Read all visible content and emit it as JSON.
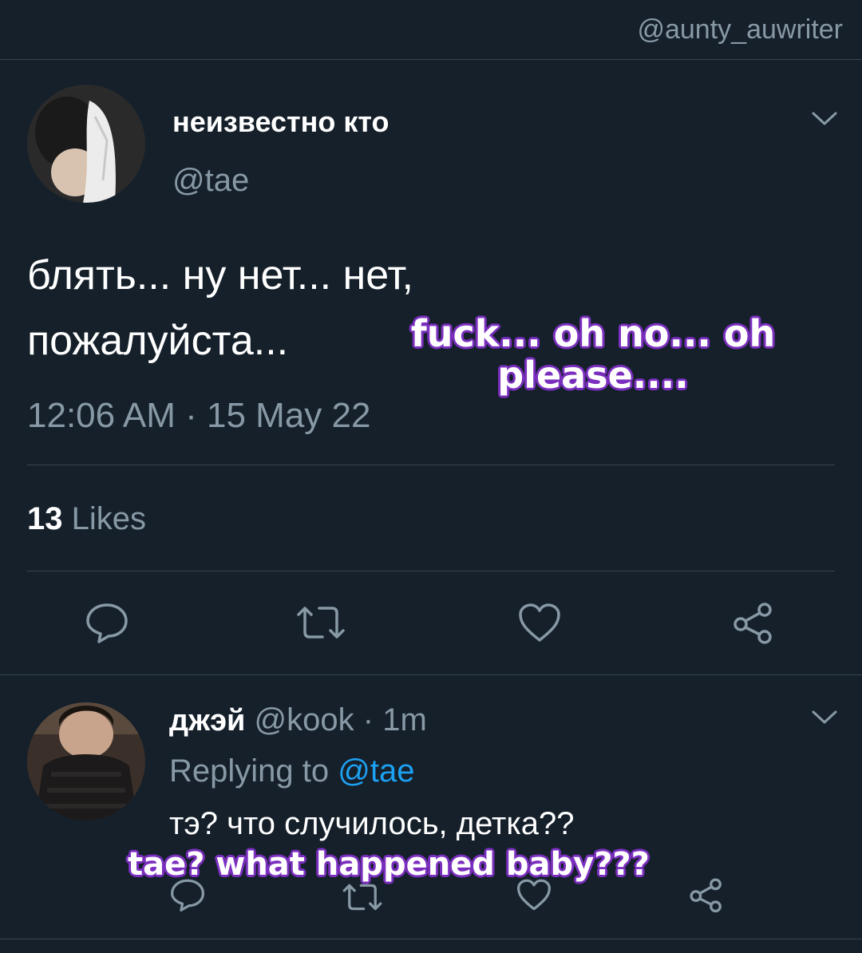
{
  "watermark": "@aunty_auwriter",
  "tweet": {
    "display_name": "неизвестно кто",
    "handle": "@tae",
    "text_line1": "блять... ну нет... нет,",
    "text_line2": "пожалуйста...",
    "translation_line1": "fuck... oh no... oh",
    "translation_line2": "please....",
    "timestamp": "12:06 AM · 15 May 22",
    "likes_count": "13",
    "likes_label": "Likes"
  },
  "reply": {
    "display_name": "джэй",
    "handle": "@kook",
    "time": "· 1m",
    "replying_prefix": "Replying to",
    "replying_mention": "@tae",
    "text": "тэ? что случилось, детка??",
    "translation": "tae? what happened baby???"
  },
  "icons": {
    "reply": "reply-icon",
    "retweet": "retweet-icon",
    "like": "heart-icon",
    "share": "share-icon",
    "chevron": "chevron-down-icon"
  },
  "colors": {
    "background": "#15202b",
    "divider": "#38444d",
    "secondary_text": "#8899a6",
    "mention": "#1da1f2",
    "translation_outline": "#7b2fbf"
  }
}
